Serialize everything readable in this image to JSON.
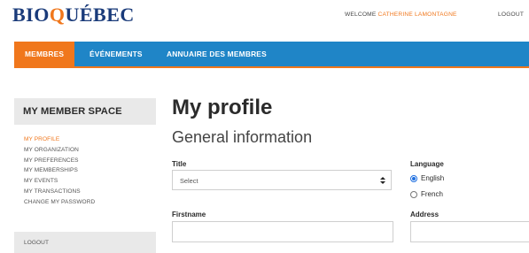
{
  "header": {
    "logo_prefix": "BIO",
    "logo_accent": "Q",
    "logo_suffix": "UÉBEC",
    "welcome_label": "WELCOME",
    "user_name": "CATHERINE LAMONTAGNE",
    "logout_label": "LOGOUT"
  },
  "nav": {
    "items": [
      {
        "label": "MEMBRES",
        "active": true
      },
      {
        "label": "ÉVÉNEMENTS",
        "active": false
      },
      {
        "label": "ANNUAIRE DES MEMBRES",
        "active": false
      }
    ]
  },
  "sidebar": {
    "title": "MY MEMBER SPACE",
    "items": [
      {
        "label": "MY PROFILE",
        "active": true
      },
      {
        "label": "MY ORGANIZATION",
        "active": false
      },
      {
        "label": "MY PREFERENCES",
        "active": false
      },
      {
        "label": "MY MEMBERSHIPS",
        "active": false
      },
      {
        "label": "MY EVENTS",
        "active": false
      },
      {
        "label": "MY TRANSACTIONS",
        "active": false
      },
      {
        "label": "CHANGE MY PASSWORD",
        "active": false
      }
    ],
    "logout_label": "LOGOUT"
  },
  "main": {
    "page_title": "My profile",
    "section_title": "General information",
    "title_field": {
      "label": "Title",
      "value": "Select"
    },
    "language_field": {
      "label": "Language",
      "options": [
        {
          "label": "English",
          "checked": true
        },
        {
          "label": "French",
          "checked": false
        }
      ]
    },
    "firstname_field": {
      "label": "Firstname",
      "value": ""
    },
    "address_field": {
      "label": "Address",
      "value": ""
    }
  },
  "colors": {
    "brand_blue": "#1f85c7",
    "accent_orange": "#f0771c",
    "logo_navy": "#1a3b7a"
  }
}
